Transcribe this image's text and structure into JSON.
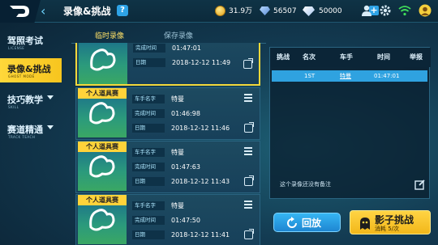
{
  "header": {
    "title": "录像&挑战",
    "help_label": "?",
    "coins": "31.9万",
    "gems": "56507",
    "diamonds": "50000",
    "plus_label": "+"
  },
  "sidebar": {
    "items": [
      {
        "label": "驾照考试",
        "sub": "LICENSE"
      },
      {
        "label": "录像&挑战",
        "sub": "GHOST MODE"
      },
      {
        "label": "技巧教学",
        "sub": "SKILL"
      },
      {
        "label": "赛道精通",
        "sub": "TRACK TEACH"
      }
    ]
  },
  "tabs": {
    "temp": "临时录像",
    "saved": "保存录像"
  },
  "cards": [
    {
      "badge": "",
      "name_label": "车手名字",
      "name": "",
      "time_label": "完成时间",
      "time": "01:47:01",
      "date_label": "日期",
      "date": "2018-12-12  11:49"
    },
    {
      "badge": "个人道具赛",
      "name_label": "车手名字",
      "name": "特曼",
      "time_label": "完成时间",
      "time": "01:46:98",
      "date_label": "日期",
      "date": "2018-12-12  11:46"
    },
    {
      "badge": "个人道具赛",
      "name_label": "车手名字",
      "name": "特曼",
      "time_label": "完成时间",
      "time": "01:47:63",
      "date_label": "日期",
      "date": "2018-12-12  11:43"
    },
    {
      "badge": "个人道具赛",
      "name_label": "车手名字",
      "name": "特曼",
      "time_label": "完成时间",
      "time": "01:47:50",
      "date_label": "日期",
      "date": "2018-12-12  11:41"
    }
  ],
  "panel": {
    "headers": [
      "挑战",
      "名次",
      "车手",
      "时间",
      "举报"
    ],
    "row": {
      "rank": "1ST",
      "driver": "特曼",
      "time": "01:47:01"
    },
    "note": "这个录像还没有备注"
  },
  "buttons": {
    "back": "回放",
    "challenge": "影子挑战",
    "cost": "消耗  5/次"
  },
  "colors": {
    "accent_yellow": "#ffd33a",
    "accent_blue": "#2fa2e0",
    "background": "#133b52"
  }
}
